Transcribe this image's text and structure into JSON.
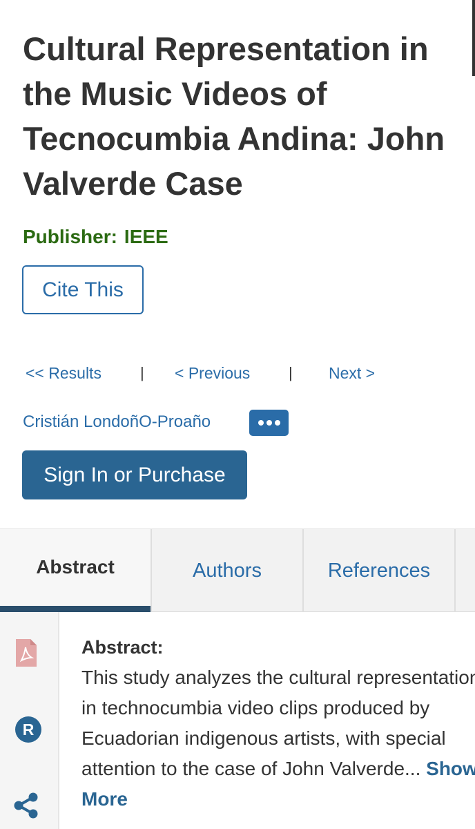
{
  "article": {
    "title": "Cultural Representation in the Music Videos of Tecnocumbia Andina: John Valverde Case",
    "publisher_label": "Publisher:",
    "publisher_value": "IEEE"
  },
  "actions": {
    "cite_label": "Cite This",
    "sign_in_label": "Sign In or Purchase"
  },
  "navigation": {
    "results": "<< Results",
    "previous": "< Previous",
    "next": "Next >",
    "separator": "|"
  },
  "authors": {
    "first_author": "Cristián LondoñO-Proaño"
  },
  "tabs": [
    {
      "label": "Abstract",
      "active": true
    },
    {
      "label": "Authors",
      "active": false
    },
    {
      "label": "References",
      "active": false
    }
  ],
  "sidebar": {
    "icons": [
      "pdf-icon",
      "rights-r-icon",
      "share-icon"
    ]
  },
  "abstract": {
    "heading": "Abstract:",
    "text": "This study analyzes the cultural representation in technocumbia video clips produced by Ecuadorian indigenous artists, with special attention to the case of John Valverde...",
    "show_more": "Show More"
  },
  "colors": {
    "link_blue": "#2a6ca8",
    "button_blue": "#2a6592",
    "publisher_green": "#2b6a12",
    "tab_indicator": "#2a4e6c",
    "text": "#333333"
  }
}
